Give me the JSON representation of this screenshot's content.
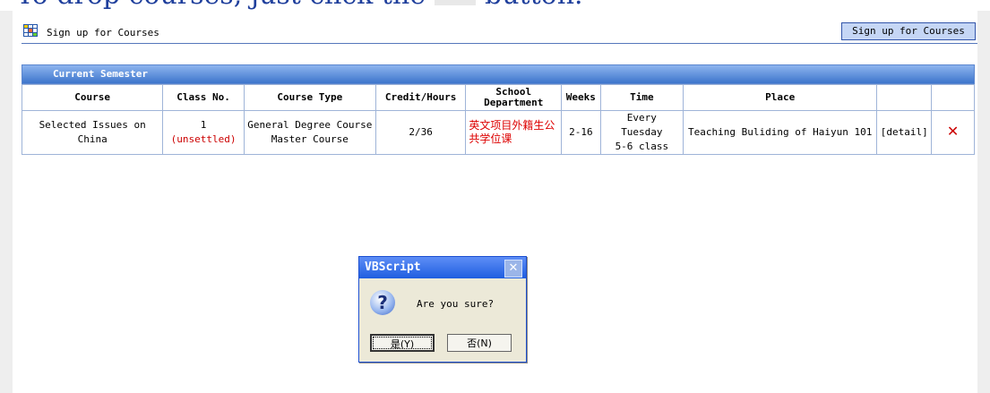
{
  "instruction": {
    "before": "To drop courses, just click the",
    "after": "button."
  },
  "header": {
    "title": "Sign up for Courses",
    "signup_button": "Sign up for Courses"
  },
  "semester": {
    "title": "Current Semester"
  },
  "table": {
    "headers": [
      "Course",
      "Class No.",
      "Course Type",
      "Credit/Hours",
      "School Department",
      "Weeks",
      "Time",
      "Place",
      "",
      ""
    ],
    "header_lines": {
      "school": [
        "School",
        "Department"
      ]
    },
    "row": {
      "course": "Selected Issues on China",
      "class_no": "1",
      "class_status": "(unsettled)",
      "course_type_1": "General Degree Course",
      "course_type_2": "Master Course",
      "credit_hours": "2/36",
      "department": "英文项目外籍生公共学位课",
      "weeks": "2-16",
      "time_1": "Every Tuesday",
      "time_2": "5-6 class",
      "place": "Teaching Buliding of Haiyun 101",
      "detail": "[detail]",
      "delete_icon": "✕"
    }
  },
  "dialog": {
    "title": "VBScript",
    "close": "✕",
    "icon": "?",
    "message": "Are you sure?",
    "yes": "是(Y)",
    "no": "否(N)"
  }
}
